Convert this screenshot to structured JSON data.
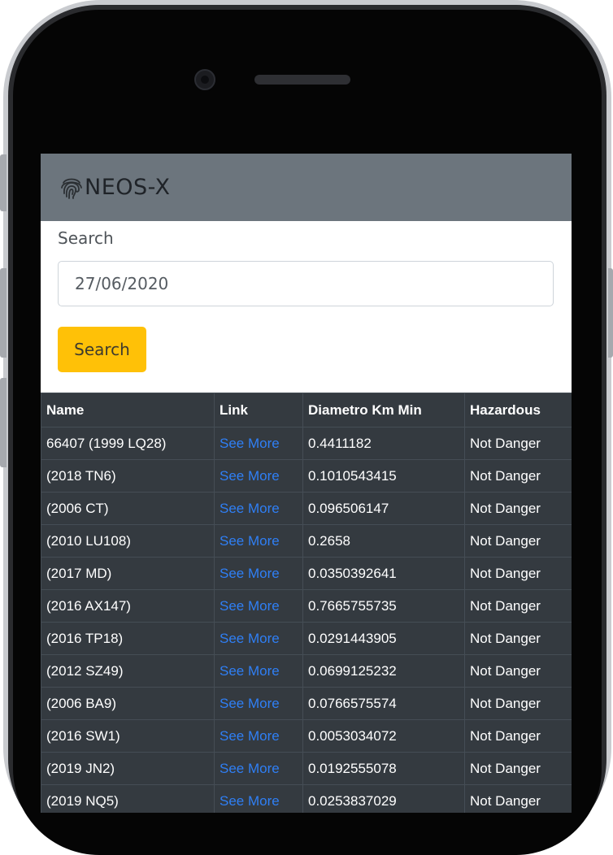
{
  "app": {
    "brand": "NEOS-X",
    "brand_icon": "fingerprint-icon"
  },
  "colors": {
    "navbar": "#6c757d",
    "button": "#ffc107",
    "table_bg": "#343a40",
    "link": "#2f7ff5"
  },
  "search": {
    "label": "Search",
    "value": "27/06/2020",
    "button_label": "Search"
  },
  "table": {
    "headers": [
      "Name",
      "Link",
      "Diametro Km Min",
      "Hazardous"
    ],
    "rows": [
      {
        "name": "66407 (1999 LQ28)",
        "link": "See More",
        "diameter": "0.4411182",
        "hazardous": "Not Danger"
      },
      {
        "name": "(2018 TN6)",
        "link": "See More",
        "diameter": "0.1010543415",
        "hazardous": "Not Danger"
      },
      {
        "name": "(2006 CT)",
        "link": "See More",
        "diameter": "0.096506147",
        "hazardous": "Not Danger"
      },
      {
        "name": "(2010 LU108)",
        "link": "See More",
        "diameter": "0.2658",
        "hazardous": "Not Danger"
      },
      {
        "name": "(2017 MD)",
        "link": "See More",
        "diameter": "0.0350392641",
        "hazardous": "Not Danger"
      },
      {
        "name": "(2016 AX147)",
        "link": "See More",
        "diameter": "0.7665755735",
        "hazardous": "Not Danger"
      },
      {
        "name": "(2016 TP18)",
        "link": "See More",
        "diameter": "0.0291443905",
        "hazardous": "Not Danger"
      },
      {
        "name": "(2012 SZ49)",
        "link": "See More",
        "diameter": "0.0699125232",
        "hazardous": "Not Danger"
      },
      {
        "name": "(2006 BA9)",
        "link": "See More",
        "diameter": "0.0766575574",
        "hazardous": "Not Danger"
      },
      {
        "name": "(2016 SW1)",
        "link": "See More",
        "diameter": "0.0053034072",
        "hazardous": "Not Danger"
      },
      {
        "name": "(2019 JN2)",
        "link": "See More",
        "diameter": "0.0192555078",
        "hazardous": "Not Danger"
      },
      {
        "name": "(2019 NQ5)",
        "link": "See More",
        "diameter": "0.0253837029",
        "hazardous": "Not Danger"
      }
    ]
  }
}
